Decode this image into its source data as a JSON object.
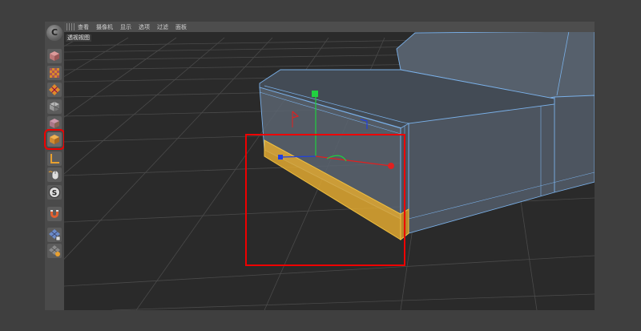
{
  "menu": {
    "items": [
      "查看",
      "摄像机",
      "显示",
      "选项",
      "过滤",
      "面板"
    ]
  },
  "viewport": {
    "label": "透视视图"
  },
  "palette": {
    "logo_text": "C",
    "tools": [
      "cube-tool-icon",
      "checker-plane-icon",
      "polygon-mesh-icon",
      "object-mode-icon",
      "points-mode-icon",
      "model-mode-icon",
      "edge-tool-icon",
      "mouse-icon",
      "snap-s-icon",
      "magnet-icon",
      "lock-grid-icon",
      "workplane-icon"
    ],
    "active_tool": "model-mode-icon"
  },
  "colors": {
    "selection": "#e0a830",
    "wireframe": "#7ab0e8",
    "highlight": "#ee0000",
    "axis_x": "#e02020",
    "axis_y": "#20d040",
    "axis_z": "#2040e0"
  }
}
